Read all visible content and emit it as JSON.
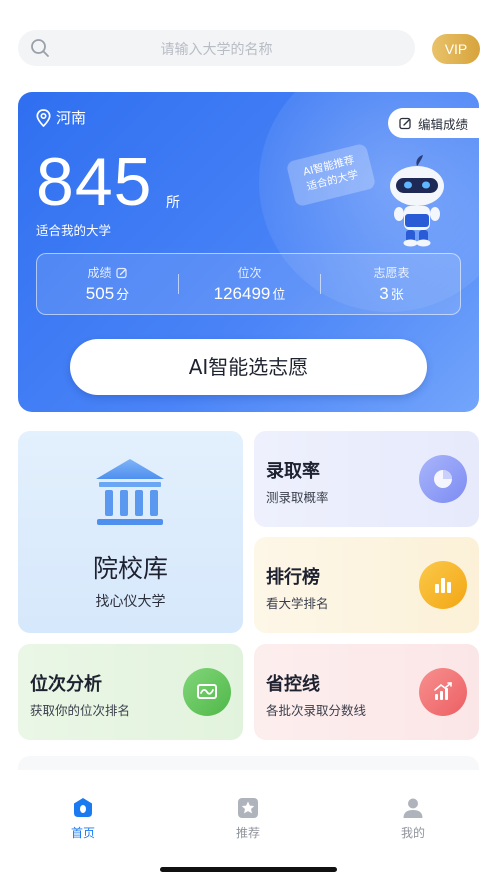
{
  "search": {
    "placeholder": "请输入大学的名称",
    "vip_label": "VIP"
  },
  "hero": {
    "province": "河南",
    "edit_score_label": "编辑成绩",
    "college_count": "845",
    "college_unit": "所",
    "fit_label": "适合我的大学",
    "bubble_line1": "AI智能推荐",
    "bubble_line2": "适合的大学",
    "stats": [
      {
        "label": "成绩",
        "value": "505",
        "unit": "分"
      },
      {
        "label": "位次",
        "value": "126499",
        "unit": "位"
      },
      {
        "label": "志愿表",
        "value": "3",
        "unit": "张"
      }
    ],
    "ai_button_label": "AI智能选志愿"
  },
  "features": {
    "library": {
      "title": "院校库",
      "subtitle": "找心仪大学"
    },
    "admission_rate": {
      "title": "录取率",
      "subtitle": "测录取概率"
    },
    "ranking": {
      "title": "排行榜",
      "subtitle": "看大学排名"
    },
    "position_analysis": {
      "title": "位次分析",
      "subtitle": "获取你的位次排名"
    },
    "control_line": {
      "title": "省控线",
      "subtitle": "各批次录取分数线"
    }
  },
  "tabs": [
    {
      "label": "首页",
      "icon": "home-icon",
      "active": true
    },
    {
      "label": "推荐",
      "icon": "star-icon",
      "active": false
    },
    {
      "label": "我的",
      "icon": "user-icon",
      "active": false
    }
  ],
  "colors": {
    "primary_blue": "#2f6ff0",
    "tab_active": "#1a7bf0",
    "vip_gold": "#d7a43c",
    "rate_badge": "#8c9bf5",
    "rank_badge": "#f7b31b",
    "position_badge": "#5cc258",
    "line_badge": "#f06b6e"
  }
}
